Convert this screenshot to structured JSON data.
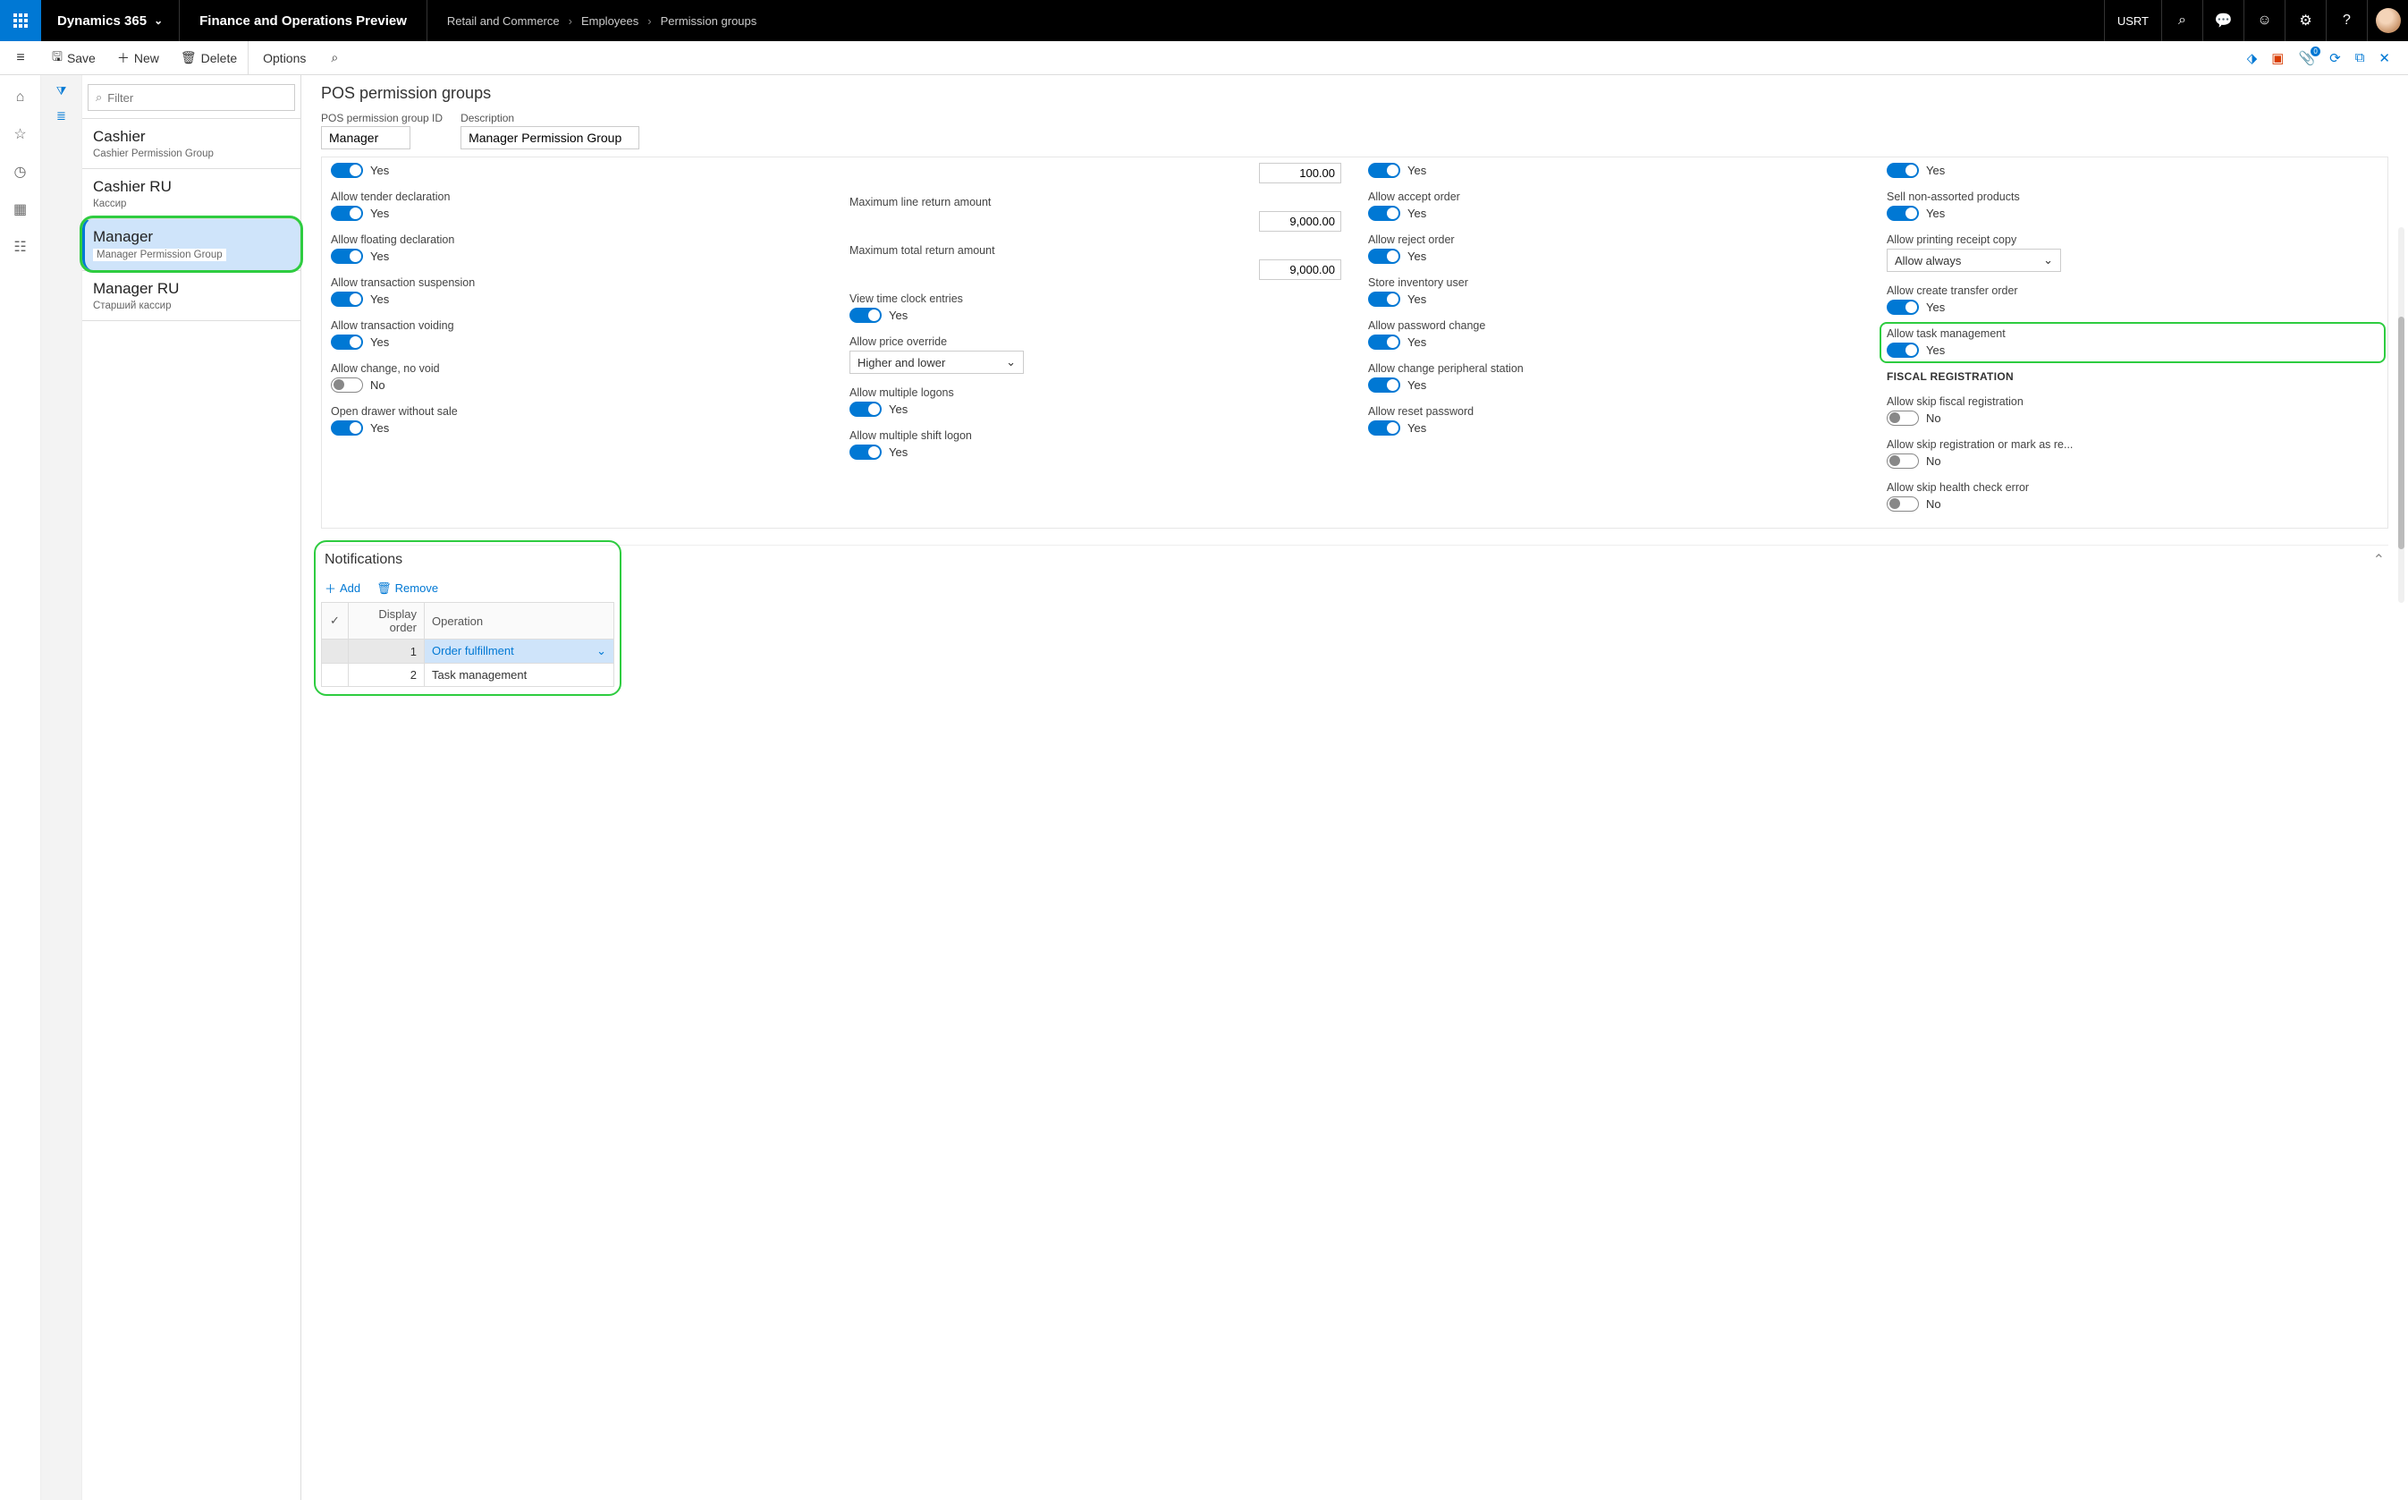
{
  "header": {
    "brand": "Dynamics 365",
    "app_title": "Finance and Operations Preview",
    "breadcrumb": [
      "Retail and Commerce",
      "Employees",
      "Permission groups"
    ],
    "company": "USRT"
  },
  "actions": {
    "save": "Save",
    "new": "New",
    "delete": "Delete",
    "options": "Options",
    "badge": "0"
  },
  "filter_placeholder": "Filter",
  "list": [
    {
      "title": "Cashier",
      "sub": "Cashier Permission Group"
    },
    {
      "title": "Cashier RU",
      "sub": "Кассир"
    },
    {
      "title": "Manager",
      "sub": "Manager Permission Group"
    },
    {
      "title": "Manager RU",
      "sub": "Старший кассир"
    }
  ],
  "page_title": "POS permission groups",
  "fields": {
    "id_label": "POS permission group ID",
    "id_value": "Manager",
    "desc_label": "Description",
    "desc_value": "Manager Permission Group"
  },
  "col1": [
    {
      "label": "",
      "val": "Yes",
      "on": true
    },
    {
      "label": "Allow tender declaration",
      "val": "Yes",
      "on": true
    },
    {
      "label": "Allow floating declaration",
      "val": "Yes",
      "on": true
    },
    {
      "label": "Allow transaction suspension",
      "val": "Yes",
      "on": true
    },
    {
      "label": "Allow transaction voiding",
      "val": "Yes",
      "on": true
    },
    {
      "label": "Allow change, no void",
      "val": "No",
      "on": false
    },
    {
      "label": "Open drawer without sale",
      "val": "Yes",
      "on": true
    }
  ],
  "col2": {
    "num1": {
      "label": "",
      "val": "100.00"
    },
    "num2": {
      "label": "Maximum line return amount",
      "val": "9,000.00"
    },
    "num3": {
      "label": "Maximum total return amount",
      "val": "9,000.00"
    },
    "t1": {
      "label": "View time clock entries",
      "val": "Yes"
    },
    "sel1": {
      "label": "Allow price override",
      "val": "Higher and lower"
    },
    "t2": {
      "label": "Allow multiple logons",
      "val": "Yes"
    },
    "t3": {
      "label": "Allow multiple shift logon",
      "val": "Yes"
    }
  },
  "col3": [
    {
      "label": "",
      "val": "Yes"
    },
    {
      "label": "Allow accept order",
      "val": "Yes"
    },
    {
      "label": "Allow reject order",
      "val": "Yes"
    },
    {
      "label": "Store inventory user",
      "val": "Yes"
    },
    {
      "label": "Allow password change",
      "val": "Yes"
    },
    {
      "label": "Allow change peripheral station",
      "val": "Yes"
    },
    {
      "label": "Allow reset password",
      "val": "Yes"
    }
  ],
  "col4": {
    "t0": {
      "label": "",
      "val": "Yes"
    },
    "t1": {
      "label": "Sell non-assorted products",
      "val": "Yes"
    },
    "sel1": {
      "label": "Allow printing receipt copy",
      "val": "Allow always"
    },
    "t2": {
      "label": "Allow create transfer order",
      "val": "Yes"
    },
    "t3": {
      "label": "Allow task management",
      "val": "Yes"
    },
    "section": "FISCAL REGISTRATION",
    "t4": {
      "label": "Allow skip fiscal registration",
      "val": "No"
    },
    "t5": {
      "label": "Allow skip registration or mark as re...",
      "val": "No"
    },
    "t6": {
      "label": "Allow skip health check error",
      "val": "No"
    }
  },
  "notifications": {
    "title": "Notifications",
    "add": "Add",
    "remove": "Remove",
    "columns": {
      "display_order": "Display order",
      "operation": "Operation"
    },
    "rows": [
      {
        "order": "1",
        "op": "Order fulfillment"
      },
      {
        "order": "2",
        "op": "Task management"
      }
    ]
  }
}
